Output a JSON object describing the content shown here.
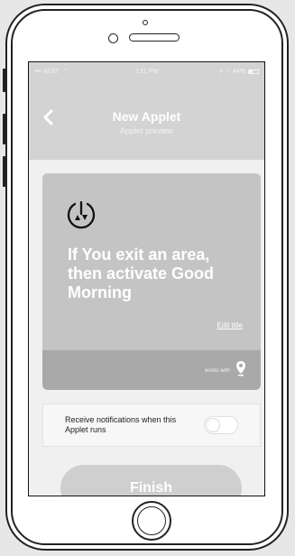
{
  "status_bar": {
    "carrier": "AT&T",
    "time": "2:11 PM",
    "battery": "44%"
  },
  "header": {
    "title": "New Applet",
    "subtitle": "Applet preview"
  },
  "card": {
    "title": "If You exit an area, then activate Good Morning",
    "edit_title": "Edit title",
    "works_with": "works with"
  },
  "notification": {
    "label": "Receive notifications when this Applet runs",
    "enabled": false
  },
  "finish_button": {
    "label": "Finish"
  },
  "icons": {
    "back": "chevron-left-icon",
    "applet": "exit-area-icon",
    "location": "location-pin-icon",
    "wifi": "wifi-icon",
    "battery": "battery-icon"
  },
  "colors": {
    "header_bg": "#d3d3d3",
    "card_bg": "#c4c4c4",
    "card_footer_bg": "#a9a9a9",
    "button_bg": "#cfcfcf"
  }
}
